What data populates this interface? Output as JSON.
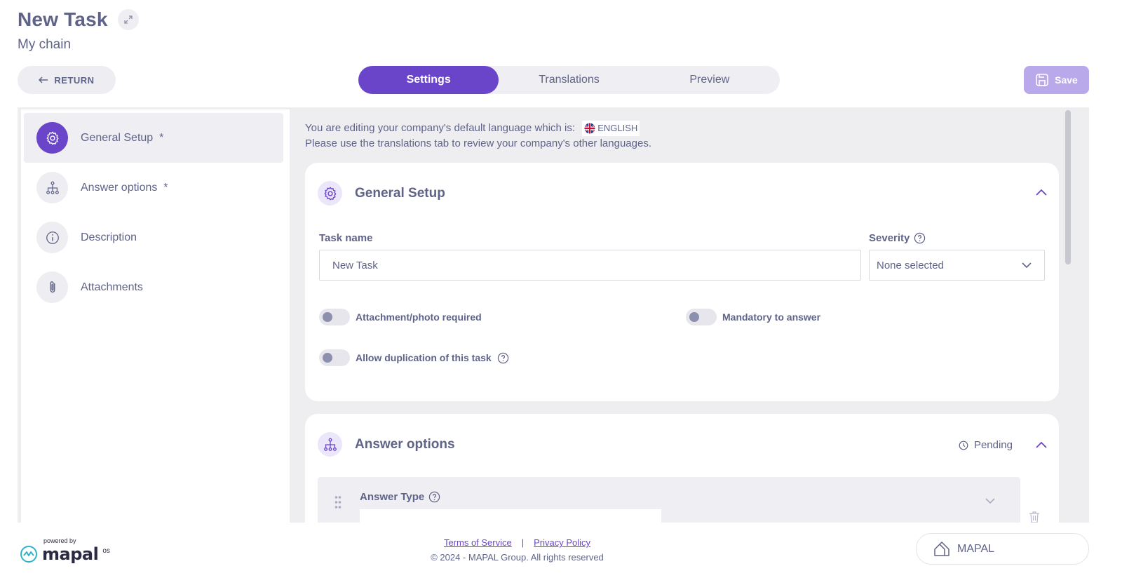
{
  "header": {
    "title": "New Task",
    "subtitle": "My chain",
    "return_label": "RETURN",
    "save_label": "Save"
  },
  "tabs": [
    {
      "label": "Settings",
      "active": true
    },
    {
      "label": "Translations",
      "active": false
    },
    {
      "label": "Preview",
      "active": false
    }
  ],
  "sidebar": {
    "items": [
      {
        "label": "General Setup",
        "required": "*",
        "icon": "gear-icon",
        "active": true
      },
      {
        "label": "Answer options",
        "required": "*",
        "icon": "tree-icon",
        "active": false
      },
      {
        "label": "Description",
        "required": "",
        "icon": "info-icon",
        "active": false
      },
      {
        "label": "Attachments",
        "required": "",
        "icon": "paperclip-icon",
        "active": false
      }
    ]
  },
  "language_note": {
    "line1": "You are editing your company's default language which is:",
    "language": "ENGLISH",
    "line2": "Please use the translations tab to review your company's other languages."
  },
  "general_setup": {
    "title": "General Setup",
    "task_name_label": "Task name",
    "task_name_value": "New Task",
    "severity_label": "Severity",
    "severity_value": "None selected",
    "toggles": {
      "attachment": "Attachment/photo required",
      "mandatory": "Mandatory to answer",
      "duplication": "Allow duplication of this task"
    }
  },
  "answer_options": {
    "title": "Answer options",
    "status": "Pending",
    "answer_type_label": "Answer Type"
  },
  "footer": {
    "powered_by": "powered by",
    "brand": "mapal",
    "brand_sup": "os",
    "terms": "Terms of Service",
    "separator": "|",
    "privacy": "Privacy Policy",
    "copyright": "© 2024 - MAPAL Group. All rights reserved",
    "company_button": "MAPAL"
  },
  "colors": {
    "accent": "#6b45c9",
    "accent_light": "#b9a8ea",
    "text": "#5f6388",
    "workspace_bg": "#eeeef1"
  }
}
